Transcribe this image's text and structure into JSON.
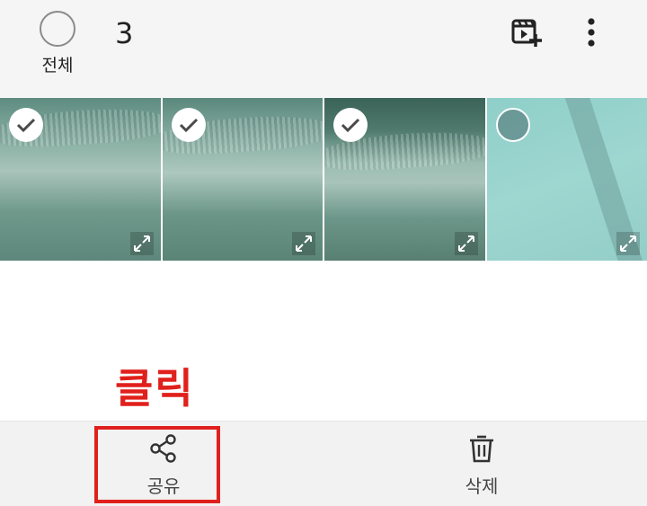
{
  "topbar": {
    "select_all_label": "전체",
    "selected_count": "3"
  },
  "thumbnails": [
    {
      "selected": true
    },
    {
      "selected": true
    },
    {
      "selected": true
    },
    {
      "selected": false
    }
  ],
  "annotation": {
    "text": "클릭",
    "color": "#e0201c"
  },
  "bottombar": {
    "share_label": "공유",
    "delete_label": "삭제"
  }
}
